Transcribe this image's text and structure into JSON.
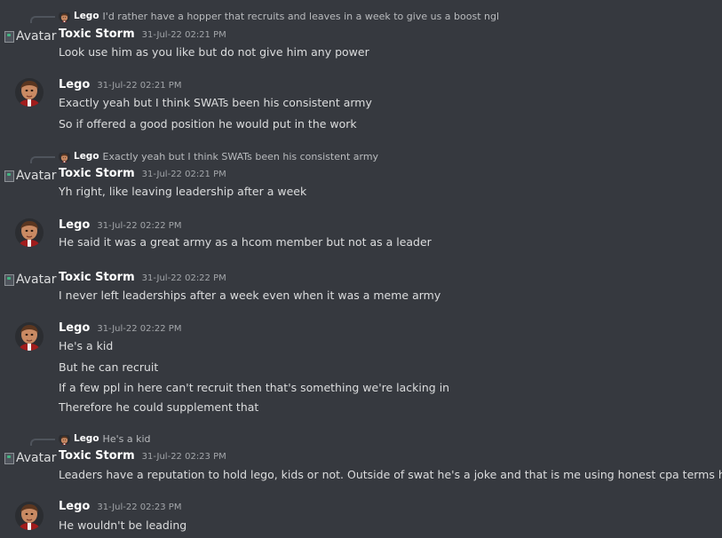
{
  "users": {
    "lego": "Lego",
    "toxic": "Toxic Storm",
    "broken_avatar_alt": "Avatar"
  },
  "colors": {
    "background": "#36393f",
    "author": "#ffffff",
    "message_text": "#dcddde",
    "timestamp": "#a3a6aa",
    "reply_text": "#b9bbbe"
  },
  "icons": {
    "lego_avatar": "lego-avatar-icon",
    "broken_image": "broken-image-icon"
  },
  "messages": [
    {
      "reply": {
        "author": "Lego",
        "text": "I'd rather have a hopper that recruits and leaves in a week to give us a boost ngl"
      },
      "author": "Toxic Storm",
      "time": "31-Jul-22 02:21 PM",
      "lines": [
        "Look use him as you like but do not give him any power"
      ]
    },
    {
      "author": "Lego",
      "time": "31-Jul-22 02:21 PM",
      "lines": [
        "Exactly yeah but I think SWATs been his consistent army",
        "So if offered a good position he would put in the work"
      ]
    },
    {
      "reply": {
        "author": "Lego",
        "text": "Exactly yeah but I think SWATs been his consistent army"
      },
      "author": "Toxic Storm",
      "time": "31-Jul-22 02:21 PM",
      "lines": [
        "Yh right, like leaving leadership after a week"
      ]
    },
    {
      "author": "Lego",
      "time": "31-Jul-22 02:22 PM",
      "lines": [
        "He said it was a great army as a hcom member but not as a leader"
      ]
    },
    {
      "author": "Toxic Storm",
      "time": "31-Jul-22 02:22 PM",
      "lines": [
        "I never left leaderships after a week even when it was a meme army"
      ]
    },
    {
      "author": "Lego",
      "time": "31-Jul-22 02:22 PM",
      "lines": [
        "He's a kid",
        "But he can recruit",
        "If a few ppl in here can't recruit then that's something we're lacking in",
        "Therefore he could supplement that"
      ]
    },
    {
      "reply": {
        "author": "Lego",
        "text": "He's a kid"
      },
      "author": "Toxic Storm",
      "time": "31-Jul-22 02:23 PM",
      "lines": [
        "Leaders have a reputation to hold lego, kids or not. Outside of swat he's a joke and that is me using honest cpa terms here"
      ]
    },
    {
      "author": "Lego",
      "time": "31-Jul-22 02:23 PM",
      "lines": [
        "He wouldn't be leading"
      ]
    }
  ]
}
